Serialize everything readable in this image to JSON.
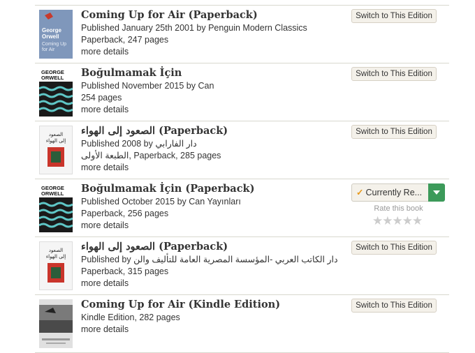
{
  "editions": [
    {
      "title": "Coming Up for Air (Paperback)",
      "published": "Published January 25th 2001 by Penguin Modern Classics",
      "format": "Paperback, 247 pages",
      "more": "more details",
      "button": "Switch to This Edition",
      "cover_text": [
        "George",
        "Orwell",
        "Coming Up",
        "for Air"
      ]
    },
    {
      "title": "Boğulmamak İçin",
      "published": "Published November 2015 by Can",
      "format": "254 pages",
      "more": "more details",
      "button": "Switch to This Edition",
      "cover_text": [
        "GEORGE",
        "ORWELL"
      ]
    },
    {
      "title": "الصعود إلى الهواء (Paperback)",
      "published": "Published 2008 by دار الفارابي",
      "format": "الطبعة الأولى, Paperback, 285 pages",
      "more": "more details",
      "button": "Switch to This Edition",
      "cover_text": [
        "الصعود",
        "إلى الهواء"
      ]
    },
    {
      "title": "Boğulmamak İçin (Paperback)",
      "published": "Published October 2015 by Can Yayınları",
      "format": "Paperback, 256 pages",
      "more": "more details",
      "button": "Currently Re...",
      "rate_label": "Rate this book",
      "stars": "★★★★★",
      "cover_text": [
        "GEORGE",
        "ORWELL"
      ]
    },
    {
      "title": "الصعود إلى الهواء (Paperback)",
      "published": "Published by دار الكاتب العربي -المؤسسة المصرية العامة للتأليف والن",
      "format": "Paperback, 315 pages",
      "more": "more details",
      "button": "Switch to This Edition",
      "cover_text": [
        "الصعود",
        "إلى الهواء"
      ]
    },
    {
      "title": "Coming Up for Air (Kindle Edition)",
      "format": "Kindle Edition, 282 pages",
      "more": "more details",
      "button": "Switch to This Edition"
    }
  ],
  "colors": {
    "button_bg": "#f4f1ea",
    "accent_green": "#3c9a5a",
    "check_orange": "#e89a1c"
  }
}
